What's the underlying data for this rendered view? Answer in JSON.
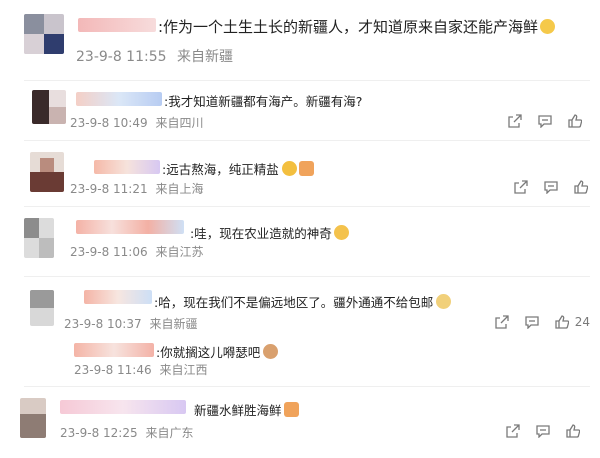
{
  "comments": [
    {
      "text": ":作为一个土生土长的新疆人，才知道原来自家还能产海鲜",
      "time": "23-9-8 11:55",
      "location": "来自新疆"
    },
    {
      "text": ":我才知道新疆都有海产。新疆有海?",
      "time": "23-9-8 10:49",
      "location": "来自四川"
    },
    {
      "text": ":远古熬海，纯正精盐",
      "time": "23-9-8 11:21",
      "location": "来自上海"
    },
    {
      "text": ":哇，现在农业造就的神奇",
      "time": "23-9-8 11:06",
      "location": "来自江苏"
    },
    {
      "text": ":哈，现在我们不是偏远地区了。疆外通通不给包邮",
      "time": "23-9-8 10:37",
      "location": "来自新疆",
      "likes": "24"
    },
    {
      "text": ":你就搁这儿嘚瑟吧",
      "time": "23-9-8 11:46",
      "location": "来自江西"
    },
    {
      "text": "新疆水鲜胜海鲜",
      "time": "23-9-8 12:25",
      "location": "来自广东"
    }
  ]
}
